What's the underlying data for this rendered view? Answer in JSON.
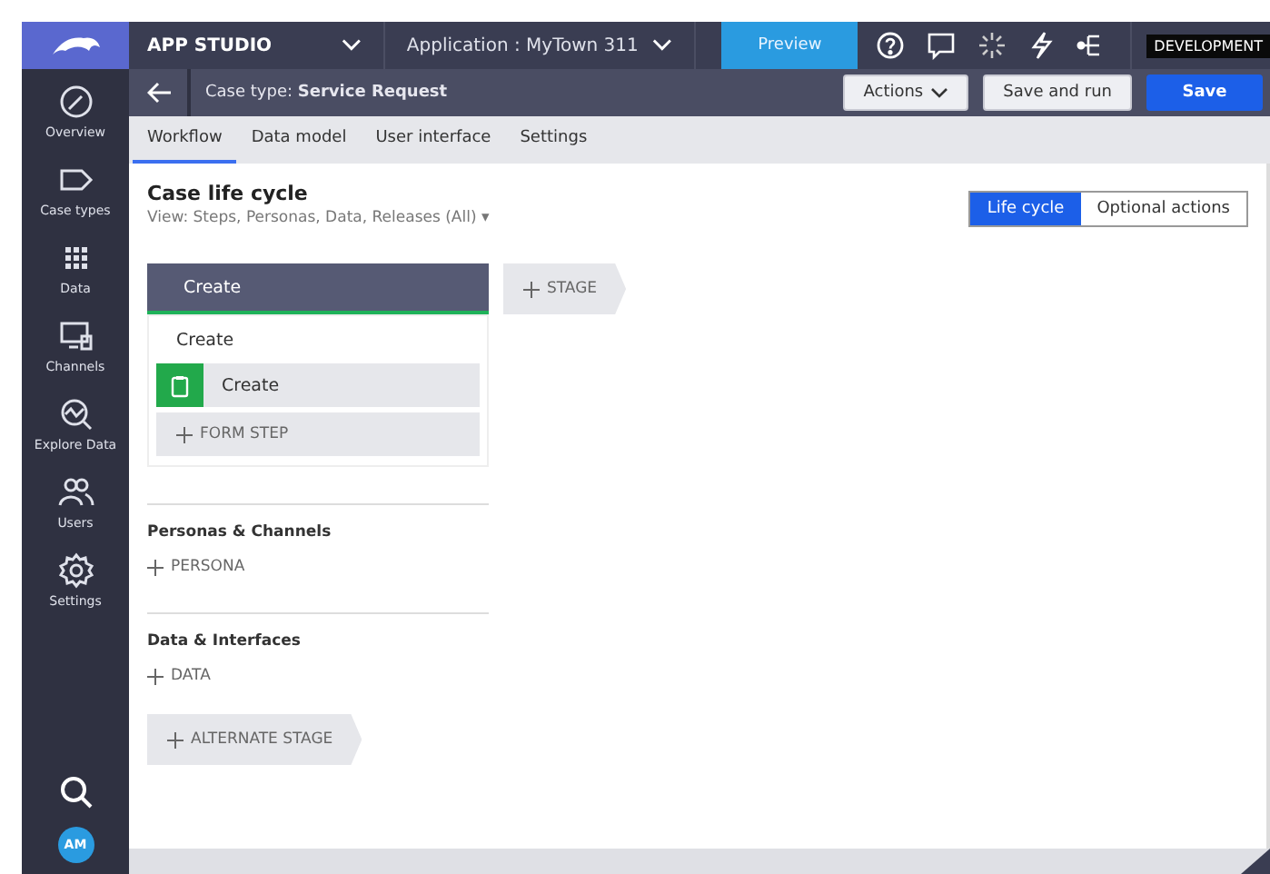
{
  "sidebar": {
    "items": [
      {
        "label": "Overview"
      },
      {
        "label": "Case types"
      },
      {
        "label": "Data"
      },
      {
        "label": "Channels"
      },
      {
        "label": "Explore Data"
      },
      {
        "label": "Users"
      },
      {
        "label": "Settings"
      }
    ],
    "avatar": "AM"
  },
  "header": {
    "studio": "APP STUDIO",
    "application": "Application : MyTown 311",
    "preview": "Preview",
    "environment": "DEVELOPMENT"
  },
  "case_bar": {
    "text": "Case type: **Service Request**",
    "buttons": [
      {
        "label": "Actions",
        "kind": "menu"
      },
      {
        "label": "Save and run",
        "kind": "plain"
      },
      {
        "label": "Save",
        "kind": "primary"
      }
    ]
  },
  "tabs": [
    {
      "label": "Workflow",
      "selected": true
    },
    {
      "label": "Data model",
      "selected": false
    },
    {
      "label": "User interface",
      "selected": false
    },
    {
      "label": "Settings",
      "selected": false
    }
  ],
  "title": "Case life cycle",
  "view": "View: Steps, Personas, Data, Releases (All) ▾",
  "toggle": [
    {
      "label": "Life cycle",
      "selected": true
    },
    {
      "label": "Optional actions",
      "selected": false
    }
  ],
  "stage": {
    "name": "Create",
    "process": "Create",
    "steps": [
      {
        "label": "Create"
      }
    ],
    "add_step": "FORM STEP"
  },
  "add_stage": "STAGE",
  "sections": [
    {
      "title": "Personas & Channels",
      "add": "PERSONA"
    },
    {
      "title": "Data & Interfaces",
      "add": "DATA"
    }
  ],
  "add_alternate": "ALTERNATE STAGE"
}
